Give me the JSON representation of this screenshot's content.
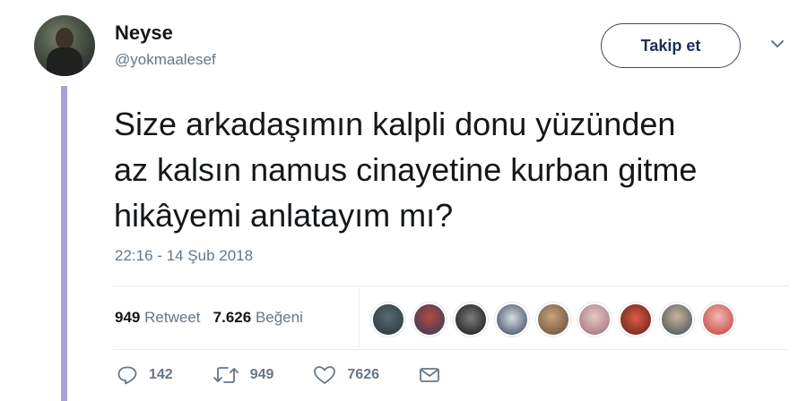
{
  "author": {
    "name": "Neyse",
    "handle": "@yokmaalesef"
  },
  "follow_button": "Takip et",
  "tweet": {
    "lines": [
      "Size arkadaşımın kalpli donu yüzünden",
      "az kalsın namus cinayetine kurban gitme",
      "hikâyemi anlatayım mı?"
    ],
    "timestamp": "22:16 - 14 Şub 2018"
  },
  "stats": {
    "retweet_count": "949",
    "retweet_label": "Retweet",
    "like_count": "7.626",
    "like_label": "Beğeni"
  },
  "actions": {
    "reply_count": "142",
    "retweet_count": "949",
    "like_count": "7626"
  },
  "icons": {
    "reply": "reply-icon",
    "retweet": "retweet-icon",
    "like": "heart-icon",
    "message": "envelope-icon",
    "caret": "chevron-down-icon"
  },
  "colors": {
    "thread_line": "#a8a3d4",
    "muted": "#657786",
    "text": "#14171a",
    "follow_border": "#3a4a5e"
  }
}
